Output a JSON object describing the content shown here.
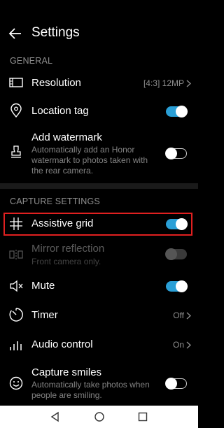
{
  "header": {
    "title": "Settings",
    "back_icon": "back-arrow-icon"
  },
  "sections": {
    "general": "GENERAL",
    "capture": "CAPTURE SETTINGS"
  },
  "settings": {
    "resolution": {
      "label": "Resolution",
      "value": "[4:3] 12MP",
      "icon": "resolution-icon"
    },
    "location_tag": {
      "label": "Location tag",
      "toggle": "on",
      "icon": "location-pin-icon"
    },
    "watermark": {
      "label": "Add watermark",
      "sub": "Automatically add an Honor watermark to photos taken with the rear camera.",
      "toggle": "off",
      "icon": "stamp-icon"
    },
    "assistive_grid": {
      "label": "Assistive grid",
      "toggle": "on",
      "icon": "grid-icon"
    },
    "mirror": {
      "label": "Mirror reflection",
      "sub": "Front camera only.",
      "toggle": "disabled",
      "icon": "mirror-icon"
    },
    "mute": {
      "label": "Mute",
      "toggle": "on",
      "icon": "speaker-mute-icon"
    },
    "timer": {
      "label": "Timer",
      "value": "Off",
      "icon": "timer-icon"
    },
    "audio_control": {
      "label": "Audio control",
      "value": "On",
      "icon": "audio-bars-icon"
    },
    "capture_smiles": {
      "label": "Capture smiles",
      "sub": "Automatically take photos when people are smiling.",
      "toggle": "off",
      "icon": "smile-icon"
    }
  },
  "navbar": {
    "back": "nav-back-icon",
    "home": "nav-home-icon",
    "recents": "nav-recents-icon"
  },
  "colors": {
    "accent": "#2a9fd6",
    "highlight": "#e02020",
    "background": "#000000"
  }
}
